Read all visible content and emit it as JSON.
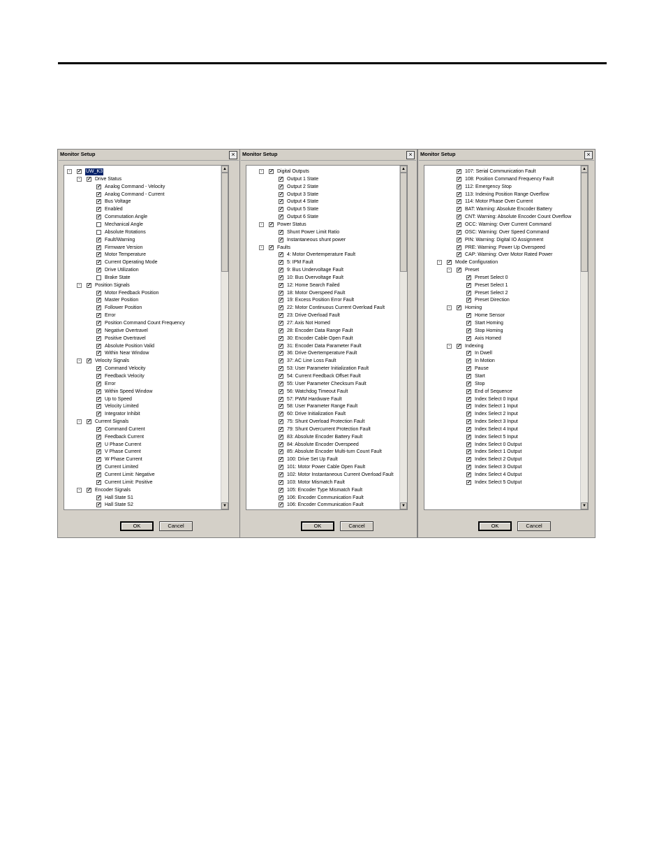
{
  "dialogs": [
    {
      "title": "Monitor Setup",
      "ok_label": "OK",
      "cancel_label": "Cancel",
      "scroll_thumb": {
        "start": 0.0,
        "end": 0.3
      },
      "items": [
        {
          "level": 0,
          "label": "UW_K3",
          "checked": true,
          "expander": "−",
          "selected": true
        },
        {
          "level": 1,
          "label": "Drive Status",
          "checked": true,
          "expander": "−"
        },
        {
          "level": 2,
          "label": "Analog Command - Velocity",
          "checked": true
        },
        {
          "level": 2,
          "label": "Analog Command - Current",
          "checked": true
        },
        {
          "level": 2,
          "label": "Bus Voltage",
          "checked": true
        },
        {
          "level": 2,
          "label": "Enabled",
          "checked": true
        },
        {
          "level": 2,
          "label": "Commutation Angle",
          "checked": true
        },
        {
          "level": 2,
          "label": "Mechanical Angle",
          "checked": false
        },
        {
          "level": 2,
          "label": "Absolute Rotations",
          "checked": false
        },
        {
          "level": 2,
          "label": "Fault/Warning",
          "checked": true
        },
        {
          "level": 2,
          "label": "Firmware Version",
          "checked": true
        },
        {
          "level": 2,
          "label": "Motor Temperature",
          "checked": true
        },
        {
          "level": 2,
          "label": "Current Operating Mode",
          "checked": true
        },
        {
          "level": 2,
          "label": "Drive Utilization",
          "checked": true
        },
        {
          "level": 2,
          "label": "Brake State",
          "checked": false
        },
        {
          "level": 1,
          "label": "Position Signals",
          "checked": true,
          "expander": "−"
        },
        {
          "level": 2,
          "label": "Motor Feedback Position",
          "checked": true
        },
        {
          "level": 2,
          "label": "Master Position",
          "checked": true
        },
        {
          "level": 2,
          "label": "Follower Position",
          "checked": true
        },
        {
          "level": 2,
          "label": "Error",
          "checked": true
        },
        {
          "level": 2,
          "label": "Position Command Count Frequency",
          "checked": true
        },
        {
          "level": 2,
          "label": "Negative Overtravel",
          "checked": true
        },
        {
          "level": 2,
          "label": "Positive Overtravel",
          "checked": true
        },
        {
          "level": 2,
          "label": "Absolute Position Valid",
          "checked": true
        },
        {
          "level": 2,
          "label": "Within Near Window",
          "checked": true
        },
        {
          "level": 1,
          "label": "Velocity Signals",
          "checked": true,
          "expander": "−"
        },
        {
          "level": 2,
          "label": "Command Velocity",
          "checked": true
        },
        {
          "level": 2,
          "label": "Feedback Velocity",
          "checked": true
        },
        {
          "level": 2,
          "label": "Error",
          "checked": true
        },
        {
          "level": 2,
          "label": "Within Speed Window",
          "checked": true
        },
        {
          "level": 2,
          "label": "Up to Speed",
          "checked": true
        },
        {
          "level": 2,
          "label": "Velocity Limited",
          "checked": true
        },
        {
          "level": 2,
          "label": "Integrator Inhibit",
          "checked": true
        },
        {
          "level": 1,
          "label": "Current Signals",
          "checked": true,
          "expander": "−"
        },
        {
          "level": 2,
          "label": "Command Current",
          "checked": true
        },
        {
          "level": 2,
          "label": "Feedback Current",
          "checked": true
        },
        {
          "level": 2,
          "label": "U Phase Current",
          "checked": true
        },
        {
          "level": 2,
          "label": "V Phase Current",
          "checked": true
        },
        {
          "level": 2,
          "label": "W Phase Current",
          "checked": true
        },
        {
          "level": 2,
          "label": "Current Limited",
          "checked": true
        },
        {
          "level": 2,
          "label": "Current Limit: Negative",
          "checked": true
        },
        {
          "level": 2,
          "label": "Current Limit: Positive",
          "checked": true
        },
        {
          "level": 1,
          "label": "Encoder Signals",
          "checked": true,
          "expander": "−"
        },
        {
          "level": 2,
          "label": "Hall State S1",
          "checked": true
        },
        {
          "level": 2,
          "label": "Hall State S2",
          "checked": true
        }
      ]
    },
    {
      "title": "Monitor Setup",
      "ok_label": "OK",
      "cancel_label": "Cancel",
      "scroll_thumb": {
        "start": 0.0,
        "end": 0.3
      },
      "items": [
        {
          "level": 1,
          "label": "Digital Outputs",
          "checked": true,
          "expander": "−"
        },
        {
          "level": 2,
          "label": "Output 1 State",
          "checked": true
        },
        {
          "level": 2,
          "label": "Output 2 State",
          "checked": true
        },
        {
          "level": 2,
          "label": "Output 3 State",
          "checked": true
        },
        {
          "level": 2,
          "label": "Output 4 State",
          "checked": true
        },
        {
          "level": 2,
          "label": "Output 5 State",
          "checked": true
        },
        {
          "level": 2,
          "label": "Output 6 State",
          "checked": true
        },
        {
          "level": 1,
          "label": "Power Status",
          "checked": true,
          "expander": "−"
        },
        {
          "level": 2,
          "label": "Shunt Power Limit Ratio",
          "checked": true
        },
        {
          "level": 2,
          "label": "Instantaneous shunt power",
          "checked": true
        },
        {
          "level": 1,
          "label": "Faults",
          "checked": true,
          "expander": "−"
        },
        {
          "level": 2,
          "label": "4: Motor Overtemperature Fault",
          "checked": true
        },
        {
          "level": 2,
          "label": "5: IPM Fault",
          "checked": true
        },
        {
          "level": 2,
          "label": "9: Bus Undervoltage Fault",
          "checked": true
        },
        {
          "level": 2,
          "label": "10: Bus Overvoltage Fault",
          "checked": true
        },
        {
          "level": 2,
          "label": "12: Home Search Failed",
          "checked": true
        },
        {
          "level": 2,
          "label": "18: Motor Overspeed Fault",
          "checked": true
        },
        {
          "level": 2,
          "label": "19: Excess Position Error Fault",
          "checked": true
        },
        {
          "level": 2,
          "label": "22: Motor Continuous Current Overload Fault",
          "checked": true
        },
        {
          "level": 2,
          "label": "23: Drive Overload Fault",
          "checked": true
        },
        {
          "level": 2,
          "label": "27: Axis Not Homed",
          "checked": true
        },
        {
          "level": 2,
          "label": "28: Encoder Data Range Fault",
          "checked": true
        },
        {
          "level": 2,
          "label": "30: Encoder Cable Open Fault",
          "checked": true
        },
        {
          "level": 2,
          "label": "31: Encoder Data Parameter Fault",
          "checked": true
        },
        {
          "level": 2,
          "label": "36: Drive Overtemperature Fault",
          "checked": true
        },
        {
          "level": 2,
          "label": "37: AC Line Loss Fault",
          "checked": true
        },
        {
          "level": 2,
          "label": "53: User Parameter Initialization Fault",
          "checked": true
        },
        {
          "level": 2,
          "label": "54: Current Feedback Offset Fault",
          "checked": true
        },
        {
          "level": 2,
          "label": "55: User Parameter Checksum Fault",
          "checked": true
        },
        {
          "level": 2,
          "label": "56: Watchdog Timeout Fault",
          "checked": true
        },
        {
          "level": 2,
          "label": "57: PWM Hardware Fault",
          "checked": true
        },
        {
          "level": 2,
          "label": "58: User Parameter Range Fault",
          "checked": true
        },
        {
          "level": 2,
          "label": "60: Drive Initialization Fault",
          "checked": true
        },
        {
          "level": 2,
          "label": "75: Shunt Overload Protection Fault",
          "checked": true
        },
        {
          "level": 2,
          "label": "79: Shunt Overcurrent Protection Fault",
          "checked": true
        },
        {
          "level": 2,
          "label": "83: Absolute Encoder Battery Fault",
          "checked": true
        },
        {
          "level": 2,
          "label": "84: Absolute Encoder Overspeed",
          "checked": true
        },
        {
          "level": 2,
          "label": "85: Absolute Encoder Multi-turn Count Fault",
          "checked": true
        },
        {
          "level": 2,
          "label": "100: Drive Set Up Fault",
          "checked": true
        },
        {
          "level": 2,
          "label": "101: Motor Power Cable Open Fault",
          "checked": true
        },
        {
          "level": 2,
          "label": "102: Motor Instantaneous Current Overload Fault",
          "checked": true
        },
        {
          "level": 2,
          "label": "103: Motor Mismatch Fault",
          "checked": true
        },
        {
          "level": 2,
          "label": "105: Encoder Type Mismatch Fault",
          "checked": true
        },
        {
          "level": 2,
          "label": "106: Encoder Communication Fault",
          "checked": true
        },
        {
          "level": 2,
          "label": "106: Encoder Communication Fault",
          "checked": true
        }
      ]
    },
    {
      "title": "Monitor Setup",
      "ok_label": "OK",
      "cancel_label": "Cancel",
      "scroll_thumb": {
        "start": 0.0,
        "end": 0.3
      },
      "items": [
        {
          "level": 2,
          "label": "107: Serial Communication Fault",
          "checked": true
        },
        {
          "level": 2,
          "label": "108: Position Command Frequency Fault",
          "checked": true
        },
        {
          "level": 2,
          "label": "112: Emergency Stop",
          "checked": true
        },
        {
          "level": 2,
          "label": "113: Indexing Position Range Overflow",
          "checked": true
        },
        {
          "level": 2,
          "label": "114: Motor Phase Over Current",
          "checked": true
        },
        {
          "level": 2,
          "label": "BAT: Warning: Absolute Encoder Battery",
          "checked": true
        },
        {
          "level": 2,
          "label": "CNT: Warning: Absolute Encoder Count Overflow",
          "checked": true
        },
        {
          "level": 2,
          "label": "OCC: Warning: Over Current Command",
          "checked": true
        },
        {
          "level": 2,
          "label": "OSC: Warning: Over Speed Command",
          "checked": true
        },
        {
          "level": 2,
          "label": "PIN: Warning: Digital IO Assignment",
          "checked": true
        },
        {
          "level": 2,
          "label": "PRE: Warning: Power Up Overspeed",
          "checked": true
        },
        {
          "level": 2,
          "label": "CAP: Warning: Over Motor Rated Power",
          "checked": true
        },
        {
          "level": 1,
          "label": "Mode Configuration",
          "checked": true,
          "expander": "−"
        },
        {
          "level": 2,
          "label": "Preset",
          "checked": true,
          "expander": "−"
        },
        {
          "level": 3,
          "label": "Preset Select 0",
          "checked": true
        },
        {
          "level": 3,
          "label": "Preset Select 1",
          "checked": true
        },
        {
          "level": 3,
          "label": "Preset Select 2",
          "checked": true
        },
        {
          "level": 3,
          "label": "Preset Direction",
          "checked": true
        },
        {
          "level": 2,
          "label": "Homing",
          "checked": true,
          "expander": "−"
        },
        {
          "level": 3,
          "label": "Home Sensor",
          "checked": true
        },
        {
          "level": 3,
          "label": "Start Homing",
          "checked": true
        },
        {
          "level": 3,
          "label": "Stop Homing",
          "checked": true
        },
        {
          "level": 3,
          "label": "Axis Homed",
          "checked": true
        },
        {
          "level": 2,
          "label": "Indexing",
          "checked": true,
          "expander": "−"
        },
        {
          "level": 3,
          "label": "In Dwell",
          "checked": true
        },
        {
          "level": 3,
          "label": "In Motion",
          "checked": true
        },
        {
          "level": 3,
          "label": "Pause",
          "checked": true
        },
        {
          "level": 3,
          "label": "Start",
          "checked": true
        },
        {
          "level": 3,
          "label": "Stop",
          "checked": true
        },
        {
          "level": 3,
          "label": "End of Sequence",
          "checked": true
        },
        {
          "level": 3,
          "label": "Index Select 0 Input",
          "checked": true
        },
        {
          "level": 3,
          "label": "Index Select 1 Input",
          "checked": true
        },
        {
          "level": 3,
          "label": "Index Select 2 Input",
          "checked": true
        },
        {
          "level": 3,
          "label": "Index Select 3 Input",
          "checked": true
        },
        {
          "level": 3,
          "label": "Index Select 4 Input",
          "checked": true
        },
        {
          "level": 3,
          "label": "Index Select 5 Input",
          "checked": true
        },
        {
          "level": 3,
          "label": "Index Select 0 Output",
          "checked": true
        },
        {
          "level": 3,
          "label": "Index Select 1 Output",
          "checked": true
        },
        {
          "level": 3,
          "label": "Index Select 2 Output",
          "checked": true
        },
        {
          "level": 3,
          "label": "Index Select 3 Output",
          "checked": true
        },
        {
          "level": 3,
          "label": "Index Select 4 Output",
          "checked": true
        },
        {
          "level": 3,
          "label": "Index Select 5 Output",
          "checked": true
        }
      ]
    }
  ]
}
